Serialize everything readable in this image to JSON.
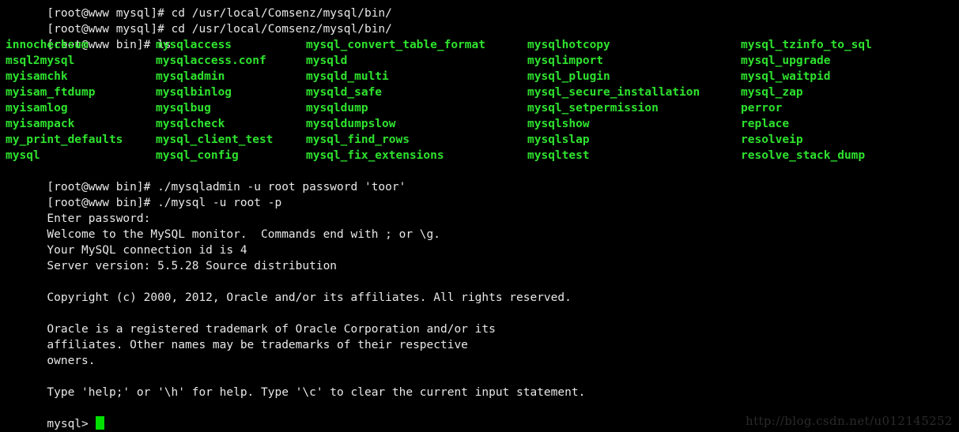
{
  "terminal": {
    "colors": {
      "background": "#000000",
      "text_white": "#e8e8e8",
      "text_green": "#2ee22e",
      "cursor": "#00e000",
      "watermark": "#2a2a2a"
    },
    "scrollback_partial_line": "[root@www mysql]# cd /usr/local/Comsenz/mysql/bin/",
    "lines": {
      "cmd_cd": "[root@www mysql]# cd /usr/local/Comsenz/mysql/bin/",
      "cmd_ls": "[root@www bin]# ls",
      "cmd_mysqladmin": "[root@www bin]# ./mysqladmin -u root password 'toor'",
      "cmd_mysql_login": "[root@www bin]# ./mysql -u root -p",
      "enter_password": "Enter password:",
      "welcome": "Welcome to the MySQL monitor.  Commands end with ; or \\g.",
      "connection_id": "Your MySQL connection id is 4",
      "server_version": "Server version: 5.5.28 Source distribution",
      "copyright": "Copyright (c) 2000, 2012, Oracle and/or its affiliates. All rights reserved.",
      "trademark_1": "Oracle is a registered trademark of Oracle Corporation and/or its",
      "trademark_2": "affiliates. Other names may be trademarks of their respective",
      "trademark_3": "owners.",
      "help_hint": "Type 'help;' or '\\h' for help. Type '\\c' to clear the current input statement.",
      "mysql_prompt": "mysql> "
    },
    "ls_output": {
      "columns": 5,
      "rows": [
        [
          "innochecksum",
          "mysqlaccess",
          "mysql_convert_table_format",
          "mysqlhotcopy",
          "mysql_tzinfo_to_sql"
        ],
        [
          "msql2mysql",
          "mysqlaccess.conf",
          "mysqld",
          "mysqlimport",
          "mysql_upgrade"
        ],
        [
          "myisamchk",
          "mysqladmin",
          "mysqld_multi",
          "mysql_plugin",
          "mysql_waitpid"
        ],
        [
          "myisam_ftdump",
          "mysqlbinlog",
          "mysqld_safe",
          "mysql_secure_installation",
          "mysql_zap"
        ],
        [
          "myisamlog",
          "mysqlbug",
          "mysqldump",
          "mysql_setpermission",
          "perror"
        ],
        [
          "myisampack",
          "mysqlcheck",
          "mysqldumpslow",
          "mysqlshow",
          "replace"
        ],
        [
          "my_print_defaults",
          "mysql_client_test",
          "mysql_find_rows",
          "mysqlslap",
          "resolveip"
        ],
        [
          "mysql",
          "mysql_config",
          "mysql_fix_extensions",
          "mysqltest",
          "resolve_stack_dump"
        ]
      ]
    },
    "watermark": "http://blog.csdn.net/u012145252"
  }
}
